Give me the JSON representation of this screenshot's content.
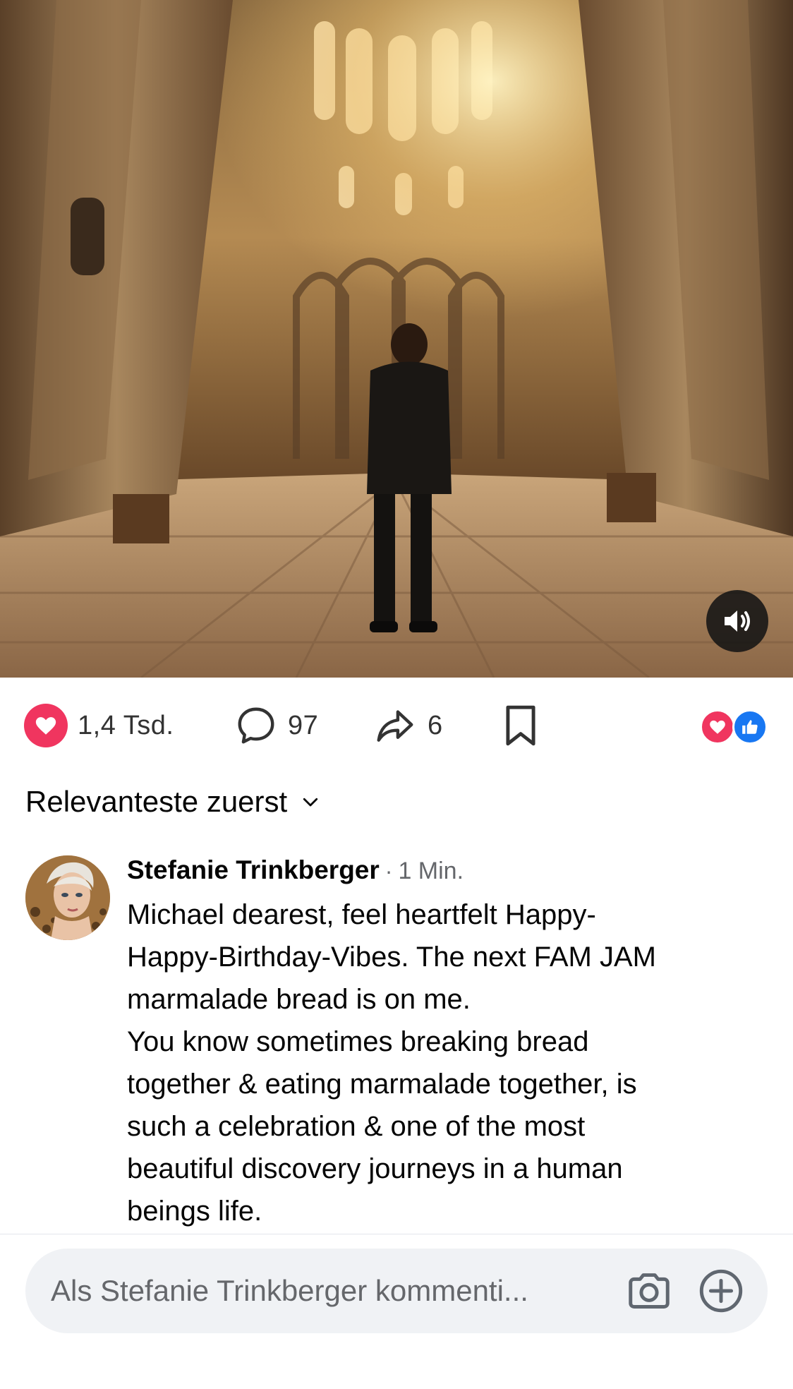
{
  "post": {
    "media": {
      "description_icon": "photo",
      "sound_button_icon": "speaker-icon"
    },
    "actions": {
      "likes": "1,4 Tsd.",
      "comments": "97",
      "shares": "6"
    },
    "reactions": [
      "heart",
      "like"
    ],
    "colors": {
      "heart": "#f0355f",
      "like": "#1877f2"
    }
  },
  "sort": {
    "label": "Relevanteste zuerst"
  },
  "comment": {
    "author": "Stefanie Trinkberger",
    "separator": "·",
    "time": "1 Min.",
    "text": "Michael dearest, feel heartfelt Happy-\nHappy-Birthday-Vibes. The next FAM JAM\nmarmalade bread is on me.\nYou know sometimes breaking bread\ntogether & eating marmalade together, is\nsuch a celebration & one of the most\nbeautiful discovery journeys in a human\nbeings life."
  },
  "composer": {
    "placeholder": "Als Stefanie Trinkberger kommenti..."
  }
}
